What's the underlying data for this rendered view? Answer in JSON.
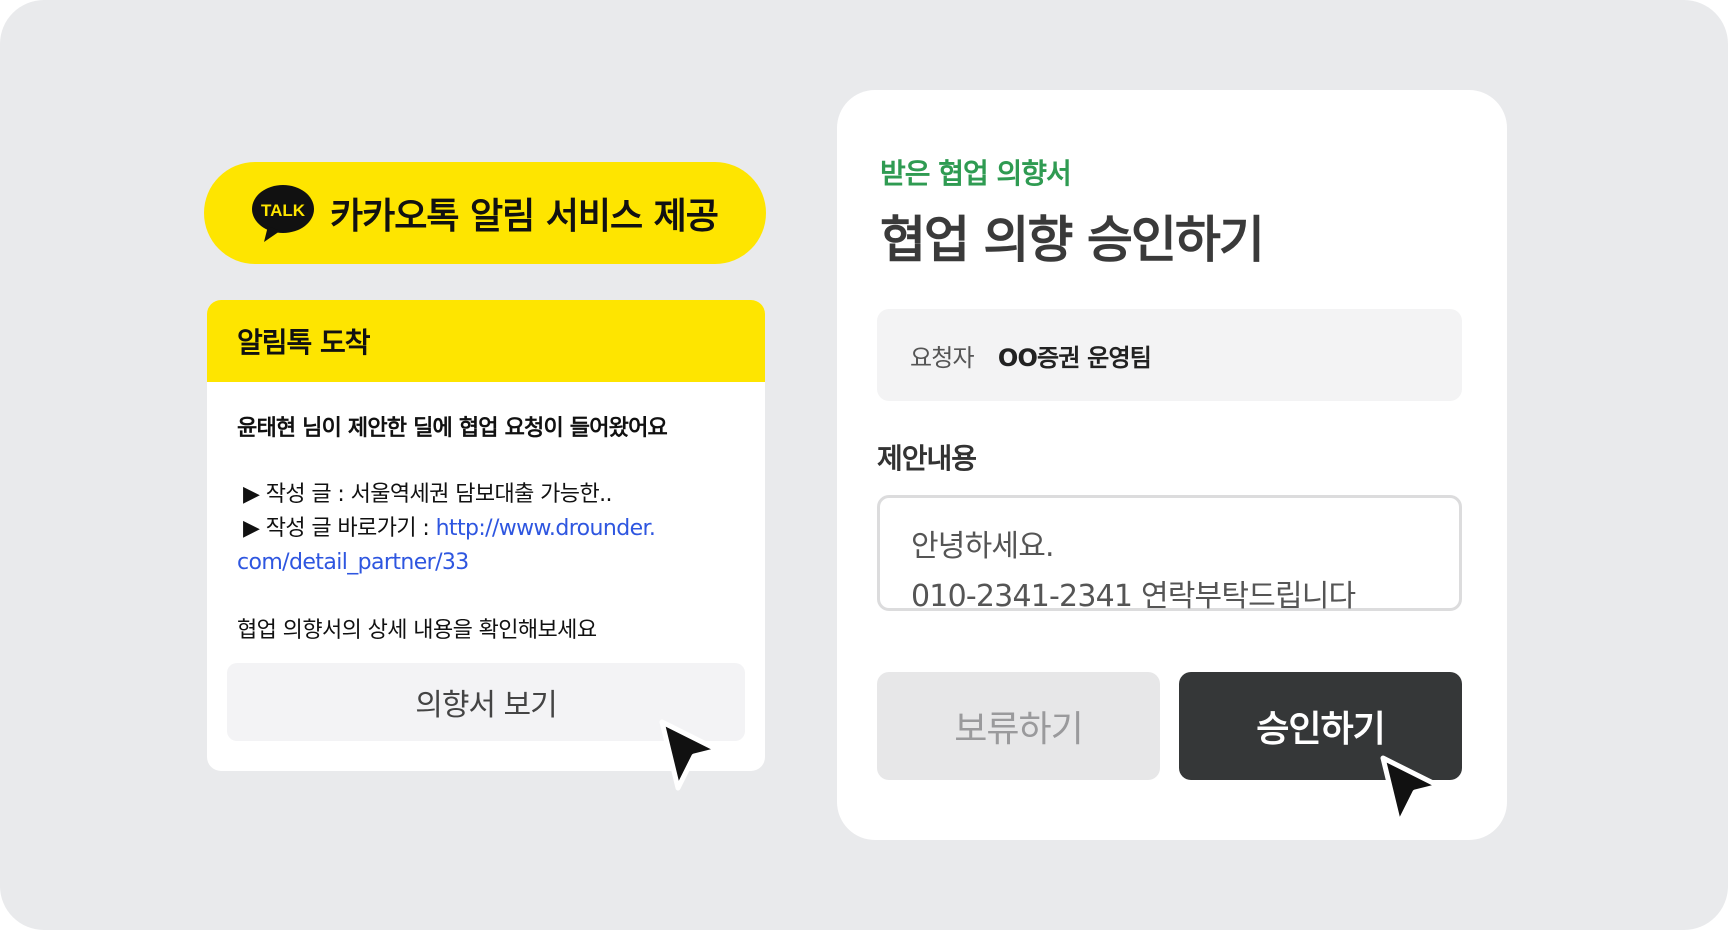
{
  "kakao_banner": {
    "icon": "kakao-talk-icon",
    "icon_text": "TALK",
    "text": "카카오톡 알림 서비스 제공",
    "color": "#fee500"
  },
  "alimtalk": {
    "header": "알림톡 도착",
    "title": "윤태현 님이 제안한 딜에 협업 요청이 들어왔어요",
    "lines": [
      {
        "prefix": "▶ 작성 글 : ",
        "text": "서울역세권 담보대출 가능한.."
      },
      {
        "prefix": "▶ 작성 글 바로가기 : ",
        "link": "http://www.drounder."
      }
    ],
    "link_continuation": "com/detail_partner/33",
    "footer": "협업 의향서의 상세 내용을 확인해보세요",
    "view_button": "의향서 보기"
  },
  "approval": {
    "subtitle": "받은 협업 의향서",
    "title": "협업 의향 승인하기",
    "requester_label": "요청자",
    "requester_value": "OO증권 운영팀",
    "proposal_label": "제안내용",
    "proposal_lines": [
      "안녕하세요.",
      "010-2341-2341 연락부탁드립니다"
    ],
    "hold_button": "보류하기",
    "approve_button": "승인하기",
    "accent_color": "#2f9b52"
  },
  "cursors": [
    "mouse-pointer-icon",
    "mouse-pointer-icon"
  ]
}
